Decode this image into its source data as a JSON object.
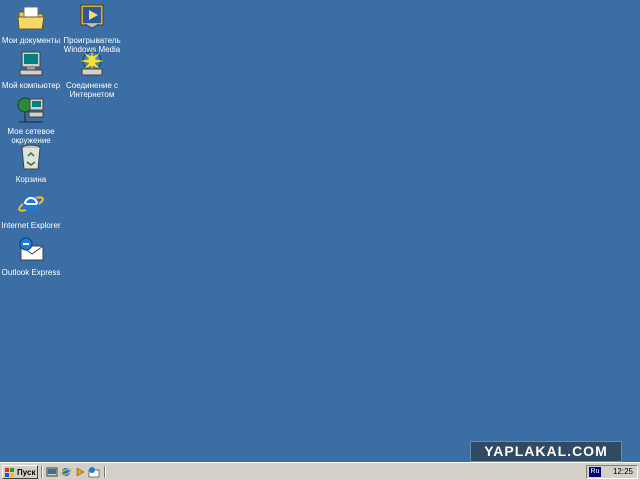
{
  "desktop": {
    "background_color": "#3a6ea5",
    "icons": [
      {
        "label": "Мои документы",
        "icon": "my-documents-folder-icon"
      },
      {
        "label": "Мой компьютер",
        "icon": "my-computer-icon"
      },
      {
        "label": "Мое сетевое\nокружение",
        "icon": "network-places-icon"
      },
      {
        "label": "Корзина",
        "icon": "recycle-bin-icon"
      },
      {
        "label": "Internet Explorer",
        "icon": "internet-explorer-icon"
      },
      {
        "label": "Outlook Express",
        "icon": "outlook-express-icon"
      },
      {
        "label": "Проигрыватель\nWindows Media",
        "icon": "windows-media-player-icon"
      },
      {
        "label": "Соединение с\nИнтернетом",
        "icon": "internet-connection-icon"
      }
    ]
  },
  "watermark": {
    "text": "YAPLAKAL.COM"
  },
  "taskbar": {
    "start_label": "Пуск",
    "quick_launch": [
      "show-desktop-icon",
      "internet-explorer-icon",
      "windows-media-player-icon",
      "outlook-express-icon"
    ],
    "tray": {
      "language": "Ru",
      "clock": "12:25"
    }
  }
}
